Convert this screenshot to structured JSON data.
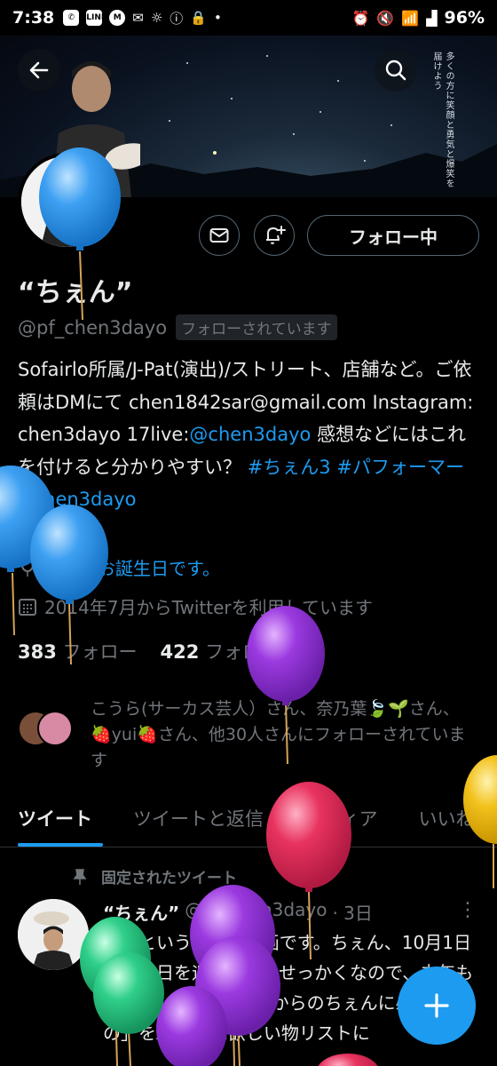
{
  "status_bar": {
    "time": "7:38",
    "battery": "96%",
    "notif_line": "LINE",
    "notif_m": "M"
  },
  "banner": {
    "vertical_text": "多くの方に笑顔と勇気と爆笑を届けよう"
  },
  "profile": {
    "name": "“ちぇん”",
    "handle": "@pf_chen3dayo",
    "follows_you": "フォローされています",
    "follow_button": "フォロー中",
    "bio_1": "Sofairlo所属/J-Pat(演出)/ストリート、店舗など。ご依頼はDMにて chen1842sar@gmail.com Instagram: chen3dayo 17live:",
    "bio_mention": "@chen3dayo",
    "bio_2": " 感想などにはこれを付けると分かりやすい？",
    "bio_tag1": "#ちぇん3",
    "bio_tag2": "#パフォーマー",
    "bio_tag3": "#chen3dayo",
    "birthday": "今日はお誕生日です。",
    "joined": "2014年7月からTwitterを利用しています",
    "following_count": "383",
    "following_label": "フォロー",
    "followers_count": "422",
    "followers_label": "フォロワー",
    "followed_by": "こうら(サーカス芸人）さん、奈乃葉🍃🌱さん、🍓yui🍓さん、他30人さんにフォローされています"
  },
  "tabs": [
    "ツイート",
    "ツイートと返信",
    "メディア",
    "いいね"
  ],
  "pinned_label": "固定されたツイート",
  "tweet": {
    "name": "“ちぇん”",
    "handle": "@pf_chen3dayo",
    "time": "· 3日",
    "text": "解禁というより、企画です。ちぇん、10月1日に誕生日を迎えます。せっかくなので、去年も行いましたが、「これからのちぇんに必要なもの」をAmazon欲しい物リストに"
  },
  "colors": {
    "accent": "#1d9bf0",
    "muted": "#71767b",
    "text": "#e7e9ea",
    "bg": "#000000"
  },
  "icons": [
    "back-arrow-icon",
    "search-icon",
    "mail-icon",
    "bell-plus-icon",
    "calendar-icon",
    "balloon-icon",
    "pin-icon",
    "more-icon",
    "plus-icon"
  ]
}
